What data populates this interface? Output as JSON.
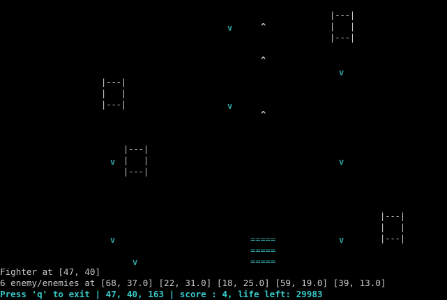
{
  "glyphs": {
    "bullet": "^",
    "enemy": "v",
    "fighter": [
      "=====",
      "=====",
      "====="
    ],
    "obstacle": "|---|\n|   |\n|---|"
  },
  "status": {
    "fighter_position": "Fighter at [47, 40]",
    "enemies": "6 enemy/enemies at [68, 37.0] [22, 31.0] [18, 25.0] [59, 19.0] [39, 13.0]",
    "controls": "Press 'q' to exit | 47, 40, 163 | score : 4, life left: 29983"
  },
  "colors": {
    "background": "#000000",
    "text": "#c8c8c8",
    "enemy": "#2fa3a3",
    "highlight": "#38c8c8"
  }
}
